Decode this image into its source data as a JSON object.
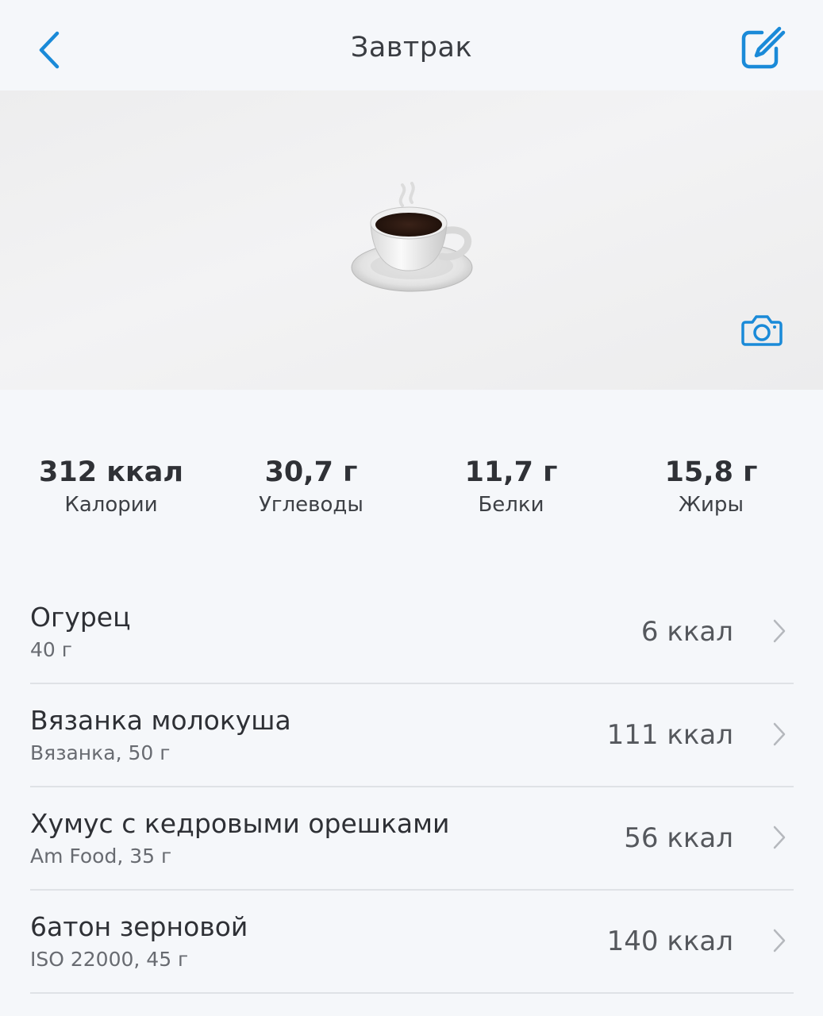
{
  "header": {
    "title": "Завтрак",
    "back_icon": "chevron-left-icon",
    "edit_icon": "edit-square-icon",
    "accent_color": "#1a8ad8"
  },
  "hero": {
    "image": "coffee-cup-emoji",
    "camera_icon": "camera-icon"
  },
  "nutrition": [
    {
      "value": "312 ккал",
      "label": "Калории"
    },
    {
      "value": "30,7 г",
      "label": "Углеводы"
    },
    {
      "value": "11,7 г",
      "label": "Белки"
    },
    {
      "value": "15,8 г",
      "label": "Жиры"
    }
  ],
  "foods": [
    {
      "name": "Огурец",
      "detail": "40 г",
      "kcal": "6 ккал"
    },
    {
      "name": "Вязанка молокуша",
      "detail": "Вязанка, 50 г",
      "kcal": "111 ккал"
    },
    {
      "name": "Хумус с кедровыми орешками",
      "detail": "Am Food, 35 г",
      "kcal": "56 ккал"
    },
    {
      "name": "6атон зерновой",
      "detail": "ISO 22000, 45 г",
      "kcal": "140 ккал"
    }
  ]
}
